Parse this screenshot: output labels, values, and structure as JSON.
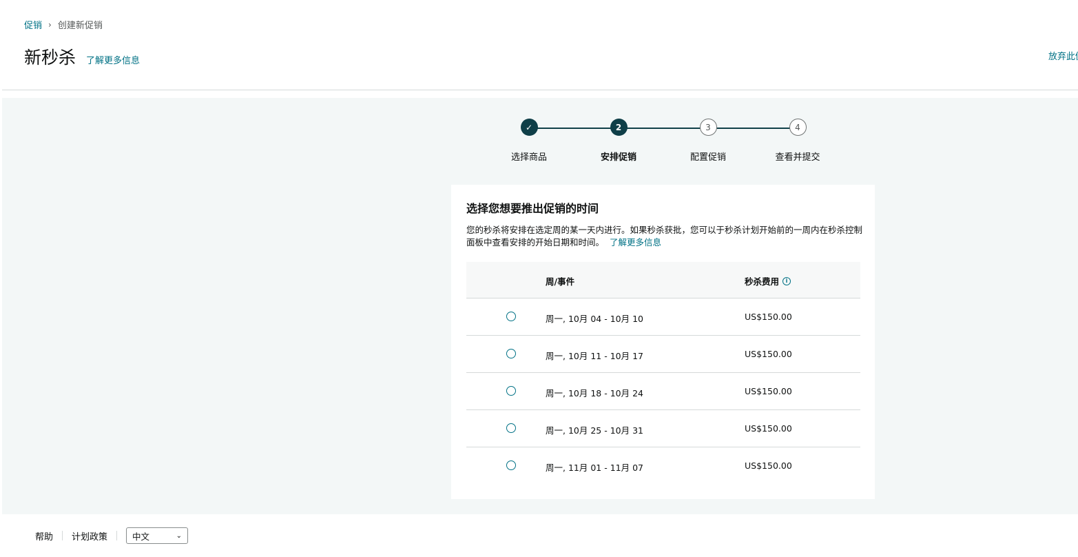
{
  "breadcrumb": {
    "root": "促销",
    "current": "创建新促销"
  },
  "header": {
    "title": "新秒杀",
    "learn_more": "了解更多信息",
    "abandon": "放弃此促销"
  },
  "stepper": {
    "steps": [
      {
        "label": "选择商品",
        "marker": "✓",
        "state": "done"
      },
      {
        "label": "安排促销",
        "marker": "2",
        "state": "active"
      },
      {
        "label": "配置促销",
        "marker": "3",
        "state": "todo"
      },
      {
        "label": "查看并提交",
        "marker": "4",
        "state": "todo"
      }
    ]
  },
  "card": {
    "title": "选择您想要推出促销的时间",
    "description": "您的秒杀将安排在选定周的某一天内进行。如果秒杀获批，您可以于秒杀计划开始前的一周内在秒杀控制面板中查看安排的开始日期和时间。",
    "learn_more": "了解更多信息"
  },
  "table": {
    "headers": {
      "week": "周/事件",
      "fee": "秒杀费用",
      "info_icon": "i"
    },
    "rows": [
      {
        "week": "周一, 10月 04 - 10月 10",
        "fee": "US$150.00"
      },
      {
        "week": "周一, 10月 11 - 10月 17",
        "fee": "US$150.00"
      },
      {
        "week": "周一, 10月 18 - 10月 24",
        "fee": "US$150.00"
      },
      {
        "week": "周一, 10月 25 - 10月 31",
        "fee": "US$150.00"
      },
      {
        "week": "周一, 11月 01 - 11月 07",
        "fee": "US$150.00"
      }
    ]
  },
  "footer": {
    "help": "帮助",
    "policy": "计划政策",
    "language": "中文"
  },
  "colors": {
    "link": "#007185",
    "step_dark": "#0f3f48",
    "background": "#f3f7f7"
  }
}
